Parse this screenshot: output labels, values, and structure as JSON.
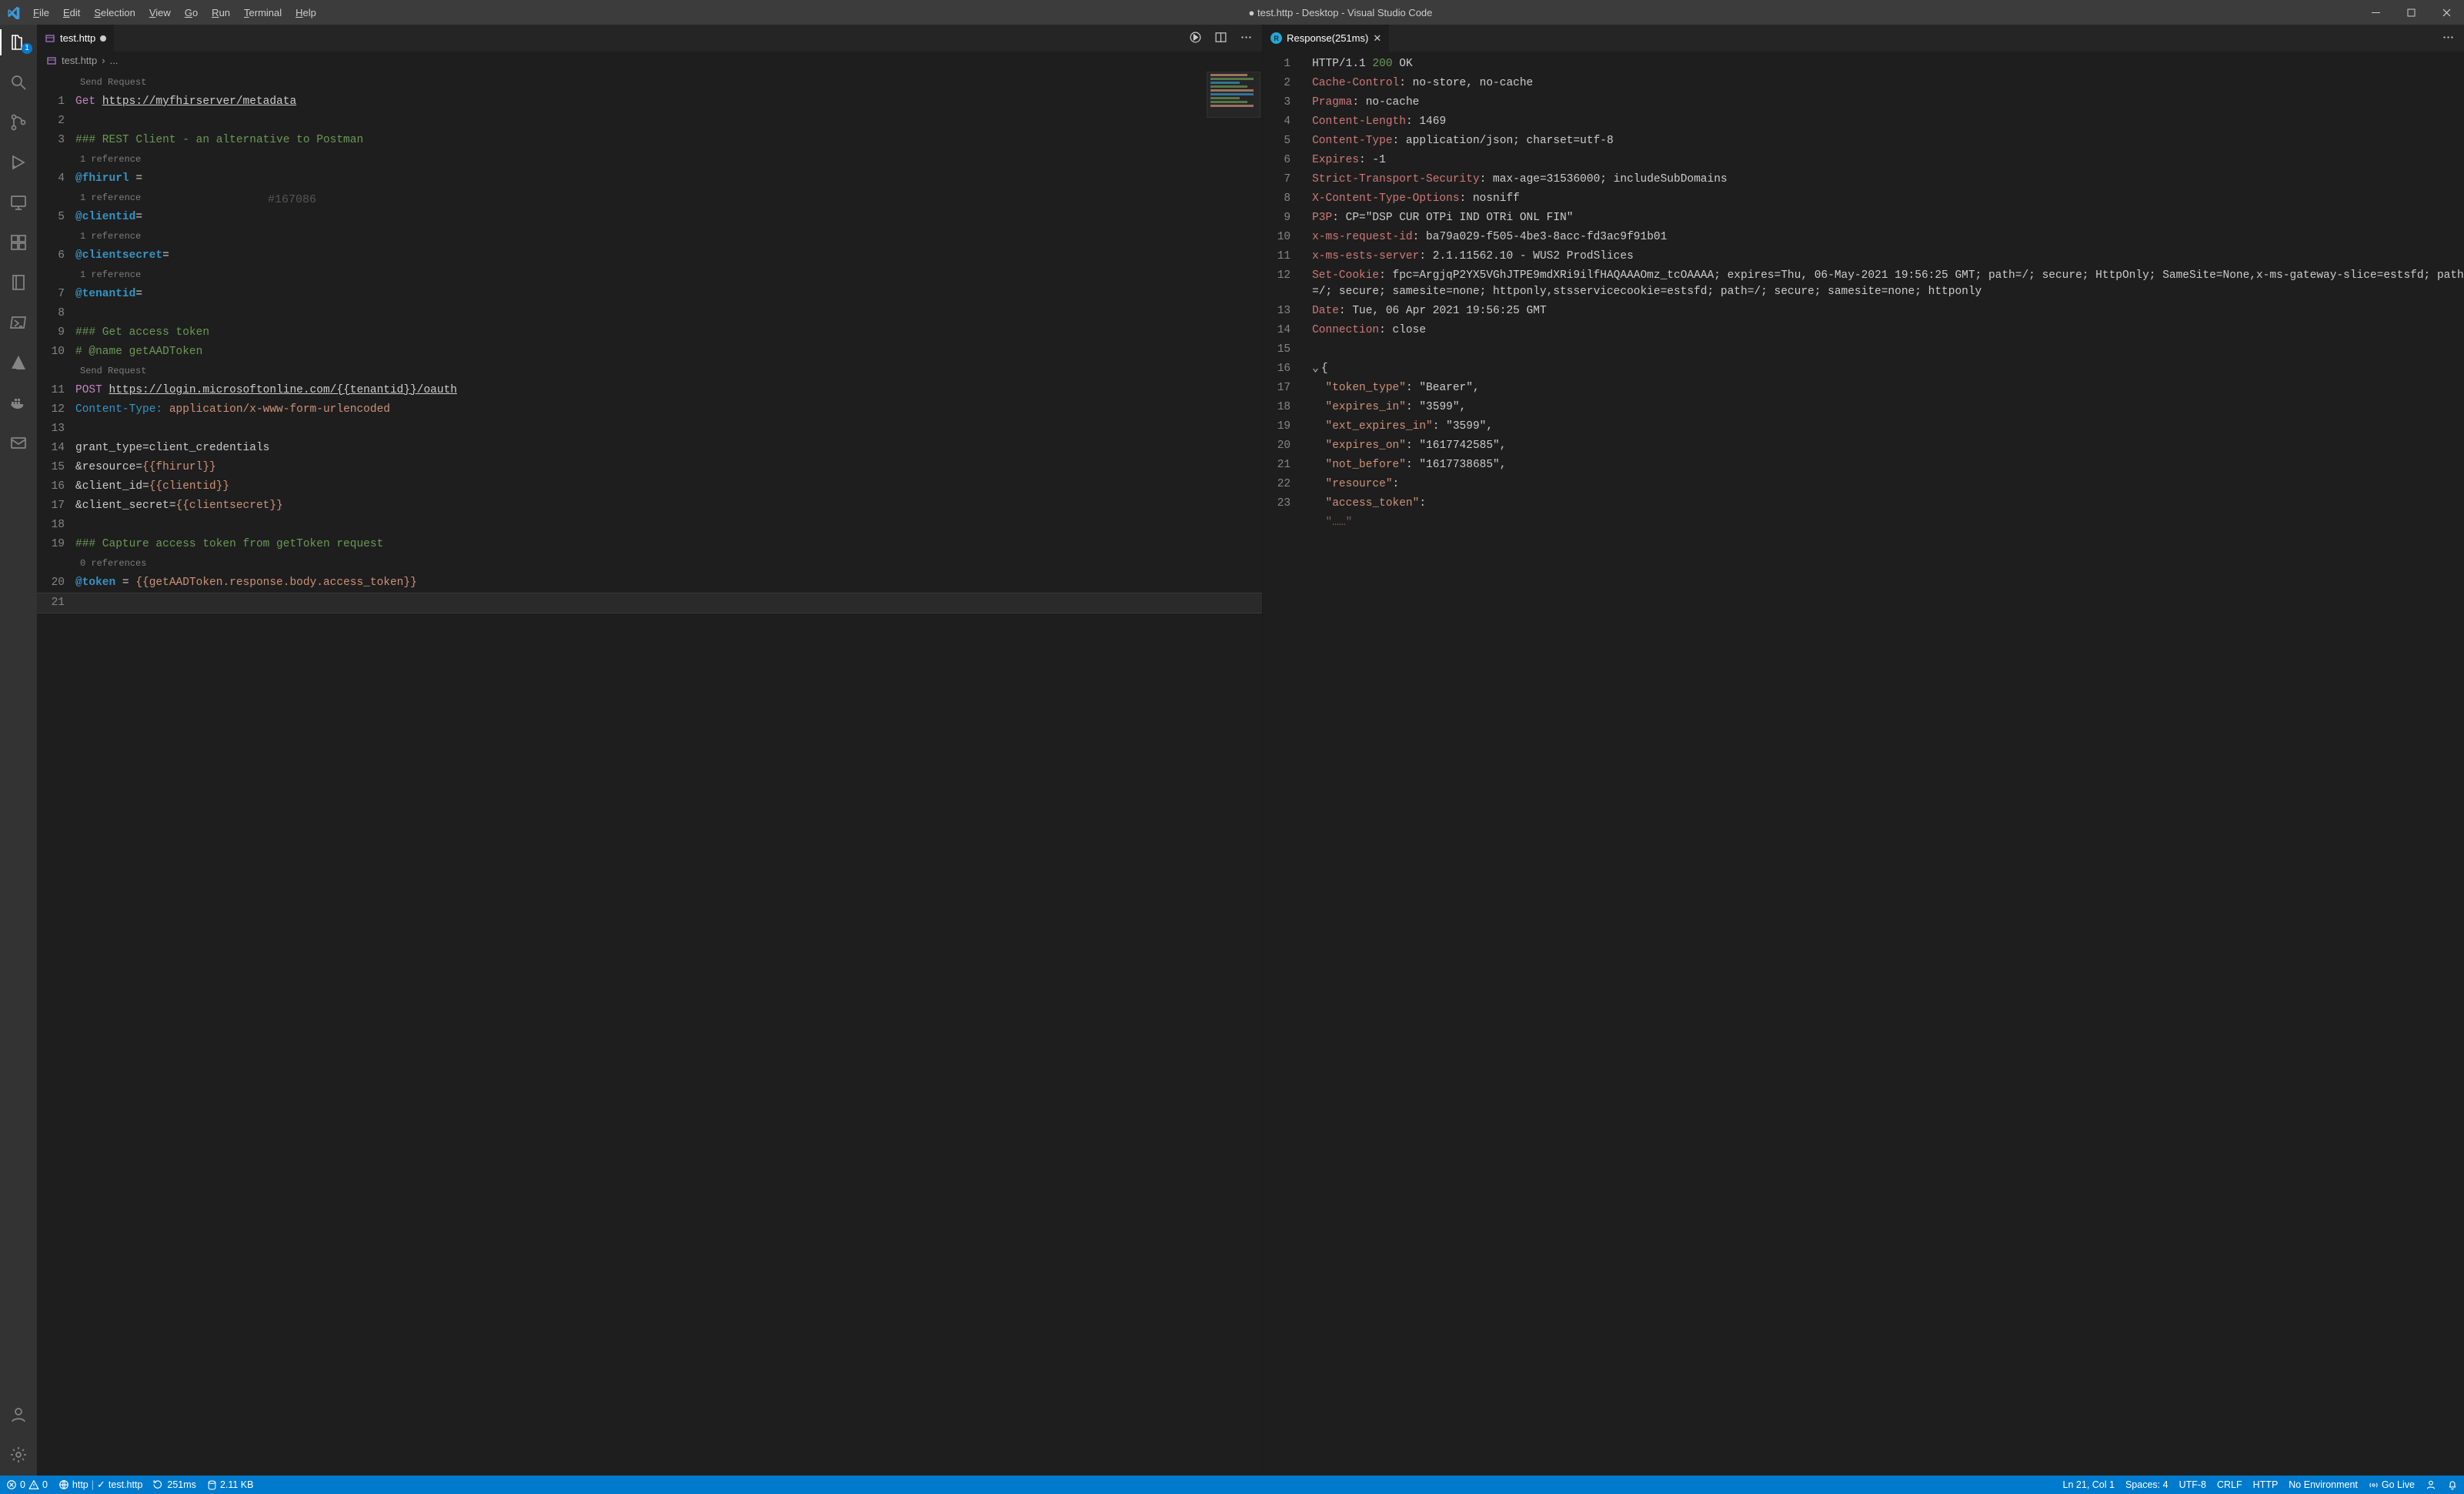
{
  "window": {
    "dirty_prefix": "●",
    "title": "test.http - Desktop - Visual Studio Code"
  },
  "menu": {
    "file": "File",
    "edit": "Edit",
    "selection": "Selection",
    "view": "View",
    "go": "Go",
    "run": "Run",
    "terminal": "Terminal",
    "help": "Help"
  },
  "activity": {
    "explorer_badge": "1"
  },
  "left_group": {
    "tab": {
      "icon": "http",
      "title": "test.http",
      "dirty": true
    },
    "breadcrumb": {
      "file": "test.http",
      "sep": "›",
      "more": "..."
    },
    "lens": {
      "send1": "Send Request",
      "ref1": "1 reference",
      "send2": "Send Request",
      "zero": "0 references"
    },
    "watermark": "#167086",
    "lines": {
      "l1": {
        "n": "1",
        "method": "Get",
        "url": "https://myfhirserver/metadata"
      },
      "l2": {
        "n": "2",
        "raw": ""
      },
      "l3": {
        "n": "3",
        "comment": "### REST Client - an alternative to Postman"
      },
      "l4": {
        "n": "4",
        "var": "@fhirurl",
        "eq": " ="
      },
      "l5": {
        "n": "5",
        "var": "@clientid",
        "eq": "="
      },
      "l6": {
        "n": "6",
        "var": "@clientsecret",
        "eq": "="
      },
      "l7": {
        "n": "7",
        "var": "@tenantid",
        "eq": "="
      },
      "l8": {
        "n": "8",
        "raw": ""
      },
      "l9": {
        "n": "9",
        "comment": "### Get access token"
      },
      "l10": {
        "n": "10",
        "comment": "# @name getAADToken"
      },
      "l11": {
        "n": "11",
        "method": "POST",
        "url": "https://login.microsoftonline.com/{{tenantid}}/oauth"
      },
      "l12": {
        "n": "12",
        "hname": "Content-Type:",
        "hval": " application/x-www-form-urlencoded"
      },
      "l13": {
        "n": "13",
        "raw": ""
      },
      "l14": {
        "n": "14",
        "body": "grant_type=client_credentials"
      },
      "l15": {
        "n": "15",
        "body_pre": "&resource=",
        "tmpl": "{{fhirurl}}"
      },
      "l16": {
        "n": "16",
        "body_pre": "&client_id=",
        "tmpl": "{{clientid}}"
      },
      "l17": {
        "n": "17",
        "body_pre": "&client_secret=",
        "tmpl": "{{clientsecret}}"
      },
      "l18": {
        "n": "18",
        "raw": ""
      },
      "l19": {
        "n": "19",
        "comment": "### Capture access token from getToken request"
      },
      "l20": {
        "n": "20",
        "var": "@token",
        "eq": " = ",
        "tmpl": "{{getAADToken.response.body.access_token}}"
      },
      "l21": {
        "n": "21",
        "raw": ""
      }
    }
  },
  "right_group": {
    "tab": {
      "title": "Response(251ms)"
    },
    "lines": {
      "l1": {
        "n": "1",
        "type": "status",
        "ver": "HTTP/1.1 ",
        "code": "200",
        "txt": " OK"
      },
      "l2": {
        "n": "2",
        "type": "hdr",
        "k": "Cache-Control",
        "v": ": no-store, no-cache"
      },
      "l3": {
        "n": "3",
        "type": "hdr",
        "k": "Pragma",
        "v": ": no-cache"
      },
      "l4": {
        "n": "4",
        "type": "hdr",
        "k": "Content-Length",
        "v": ": 1469"
      },
      "l5": {
        "n": "5",
        "type": "hdr",
        "k": "Content-Type",
        "v": ": application/json; charset=utf-8"
      },
      "l6": {
        "n": "6",
        "type": "hdr",
        "k": "Expires",
        "v": ": -1"
      },
      "l7": {
        "n": "7",
        "type": "hdr",
        "k": "Strict-Transport-Security",
        "v": ": max-age=31536000; includeSubDomains"
      },
      "l8": {
        "n": "8",
        "type": "hdr",
        "k": "X-Content-Type-Options",
        "v": ": nosniff"
      },
      "l9": {
        "n": "9",
        "type": "hdr",
        "k": "P3P",
        "v": ": CP=\"DSP CUR OTPi IND OTRi ONL FIN\""
      },
      "l10": {
        "n": "10",
        "type": "hdr",
        "k": "x-ms-request-id",
        "v": ": ba79a029-f505-4be3-8acc-fd3ac9f91b01"
      },
      "l11": {
        "n": "11",
        "type": "hdr",
        "k": "x-ms-ests-server",
        "v": ": 2.1.11562.10 - WUS2 ProdSlices"
      },
      "l12": {
        "n": "12",
        "type": "hdr",
        "k": "Set-Cookie",
        "v": ": fpc=ArgjqP2YX5VGhJTPE9mdXRi9ilfHAQAAAOmz_tcOAAAA; expires=Thu, 06-May-2021 19:56:25 GMT; path=/; secure; HttpOnly; SameSite=None,x-ms-gateway-slice=estsfd; path=/; secure; samesite=none; httponly,stsservicecookie=estsfd; path=/; secure; samesite=none; httponly"
      },
      "l13": {
        "n": "13",
        "type": "hdr",
        "k": "Date",
        "v": ": Tue, 06 Apr 2021 19:56:25 GMT"
      },
      "l14": {
        "n": "14",
        "type": "hdr",
        "k": "Connection",
        "v": ": close"
      },
      "l15": {
        "n": "15",
        "type": "blank",
        "v": ""
      },
      "l16": {
        "n": "16",
        "type": "brace",
        "v": "{"
      },
      "l17": {
        "n": "17",
        "type": "json",
        "k": "\"token_type\"",
        "v": ": \"Bearer\","
      },
      "l18": {
        "n": "18",
        "type": "json",
        "k": "\"expires_in\"",
        "v": ": \"3599\","
      },
      "l19": {
        "n": "19",
        "type": "json",
        "k": "\"ext_expires_in\"",
        "v": ": \"3599\","
      },
      "l20": {
        "n": "20",
        "type": "json",
        "k": "\"expires_on\"",
        "v": ": \"1617742585\","
      },
      "l21": {
        "n": "21",
        "type": "json",
        "k": "\"not_before\"",
        "v": ": \"1617738685\","
      },
      "l22": {
        "n": "22",
        "type": "json",
        "k": "\"resource\"",
        "v": ":"
      },
      "l23": {
        "n": "23",
        "type": "json",
        "k": "\"access_token\"",
        "v": ":"
      }
    }
  },
  "status": {
    "errors": "0",
    "warnings": "0",
    "rest_label": "http",
    "test_file": "test.http",
    "timer": "251ms",
    "size": "2.11 KB",
    "cursor": "Ln 21, Col 1",
    "spaces": "Spaces: 4",
    "encoding": "UTF-8",
    "eol": "CRLF",
    "lang": "HTTP",
    "env": "No Environment",
    "golive": "Go Live"
  }
}
